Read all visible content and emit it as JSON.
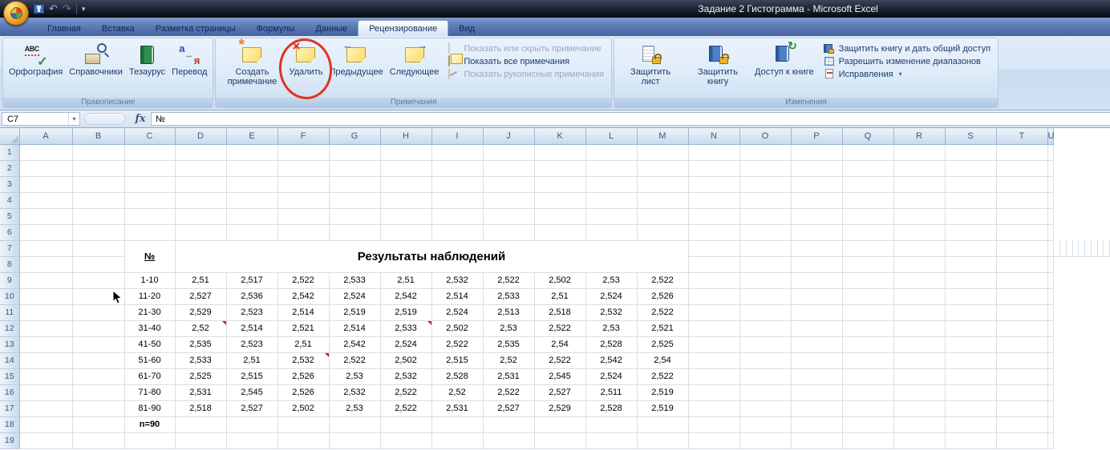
{
  "window": {
    "title": "Задание 2 Гистограмма  -  Microsoft Excel"
  },
  "icons": {
    "abc": "ABC",
    "check": "✓",
    "cross": "×",
    "star": "*",
    "arrow_left": "←",
    "arrow_right": "→",
    "circular": "↻",
    "undo": "↶",
    "redo": "↷",
    "dropdown": "▾",
    "translate_a": "а",
    "translate_b": "я",
    "swap": "↔"
  },
  "ribbon": {
    "tabs": [
      "Главная",
      "Вставка",
      "Разметка страницы",
      "Формулы",
      "Данные",
      "Рецензирование",
      "Вид"
    ],
    "active_tab": "Рецензирование",
    "proofing": {
      "label": "Правописание",
      "buttons": [
        "Орфография",
        "Справочники",
        "Тезаурус",
        "Перевод"
      ]
    },
    "comments": {
      "label": "Примечания",
      "buttons": [
        "Создать примечание",
        "Удалить",
        "Предыдущее",
        "Следующее"
      ],
      "toggles": [
        {
          "label": "Показать или скрыть примечание",
          "enabled": false
        },
        {
          "label": "Показать все примечания",
          "enabled": true
        },
        {
          "label": "Показать рукописные примечания",
          "enabled": false
        }
      ]
    },
    "changes": {
      "label": "Изменения",
      "buttons": [
        "Защитить лист",
        "Защитить книгу",
        "Доступ к книге"
      ],
      "items": [
        {
          "label": "Защитить книгу и дать общий доступ",
          "has_dropdown": false
        },
        {
          "label": "Разрешить изменение диапазонов",
          "has_dropdown": false
        },
        {
          "label": "Исправления",
          "has_dropdown": true
        }
      ]
    }
  },
  "formula_bar": {
    "name_box": "C7",
    "fx": "fx",
    "content": "№"
  },
  "sheet": {
    "columns": [
      "A",
      "B",
      "C",
      "D",
      "E",
      "F",
      "G",
      "H",
      "I",
      "J",
      "K",
      "L",
      "M",
      "N",
      "O",
      "P",
      "Q",
      "R",
      "S",
      "T",
      "U"
    ],
    "rows_visible": 19,
    "header_cell": "№",
    "title": "Результаты наблюдений",
    "row_labels": [
      "1-10",
      "11-20",
      "21-30",
      "31-40",
      "41-50",
      "51-60",
      "61-70",
      "71-80",
      "81-90"
    ],
    "values": [
      [
        "2,51",
        "2,517",
        "2,522",
        "2,533",
        "2,51",
        "2,532",
        "2,522",
        "2,502",
        "2,53",
        "2,522"
      ],
      [
        "2,527",
        "2,536",
        "2,542",
        "2,524",
        "2,542",
        "2,514",
        "2,533",
        "2,51",
        "2,524",
        "2,526"
      ],
      [
        "2,529",
        "2,523",
        "2,514",
        "2,519",
        "2,519",
        "2,524",
        "2,513",
        "2,518",
        "2,532",
        "2,522"
      ],
      [
        "2,52",
        "2,514",
        "2,521",
        "2,514",
        "2,533",
        "2,502",
        "2,53",
        "2,522",
        "2,53",
        "2,521"
      ],
      [
        "2,535",
        "2,523",
        "2,51",
        "2,542",
        "2,524",
        "2,522",
        "2,535",
        "2,54",
        "2,528",
        "2,525"
      ],
      [
        "2,533",
        "2,51",
        "2,532",
        "2,522",
        "2,502",
        "2,515",
        "2,52",
        "2,522",
        "2,542",
        "2,54"
      ],
      [
        "2,525",
        "2,515",
        "2,526",
        "2,53",
        "2,532",
        "2,528",
        "2,531",
        "2,545",
        "2,524",
        "2,522"
      ],
      [
        "2,531",
        "2,545",
        "2,526",
        "2,532",
        "2,522",
        "2,52",
        "2,522",
        "2,527",
        "2,511",
        "2,519"
      ],
      [
        "2,518",
        "2,527",
        "2,502",
        "2,53",
        "2,522",
        "2,531",
        "2,527",
        "2,529",
        "2,528",
        "2,519"
      ]
    ],
    "footer": "n=90",
    "comment_cells": [
      {
        "data_row": 3,
        "value_col": 0
      },
      {
        "data_row": 3,
        "value_col": 4
      },
      {
        "data_row": 5,
        "value_col": 2
      }
    ]
  },
  "annotation": {
    "type": "red-ellipse",
    "target": "Удалить"
  }
}
